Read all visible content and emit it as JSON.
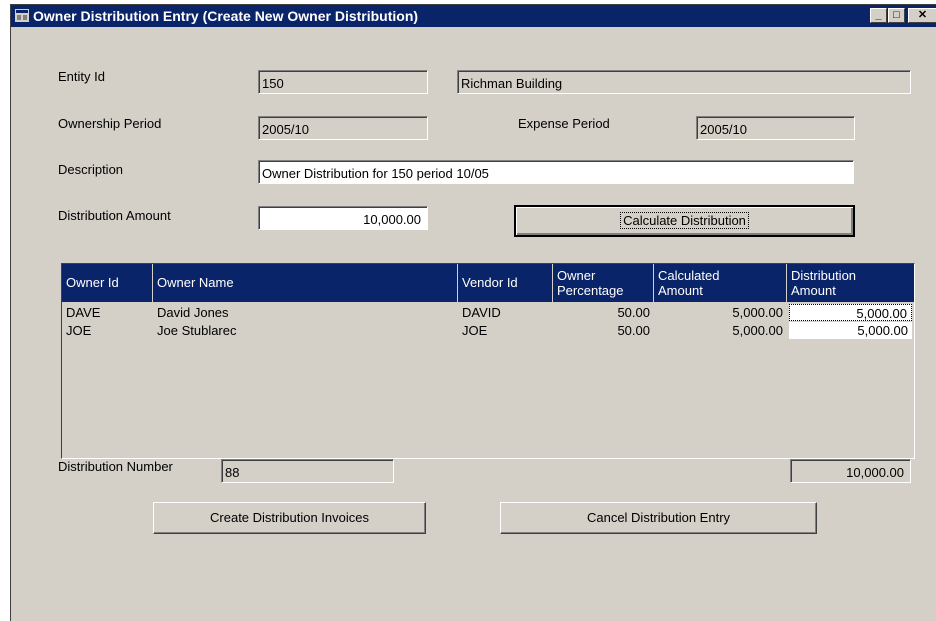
{
  "window": {
    "title": "Owner Distribution Entry (Create New Owner Distribution)"
  },
  "form": {
    "entity_label": "Entity Id",
    "entity_id": "150",
    "entity_name": "Richman Building",
    "ownership_period_label": "Ownership Period",
    "ownership_period": "2005/10",
    "expense_period_label": "Expense Period",
    "expense_period": "2005/10",
    "description_label": "Description",
    "description": "Owner Distribution for 150 period 10/05",
    "distribution_amount_label": "Distribution Amount",
    "distribution_amount": "10,000.00",
    "calculate_button": "Calculate Distribution"
  },
  "table": {
    "headers": [
      "Owner Id",
      "Owner Name",
      "Vendor Id",
      "Owner Percentage",
      "Calculated Amount",
      "Distribution Amount"
    ],
    "rows": [
      [
        "DAVE",
        "David Jones",
        "DAVID",
        "50.00",
        "5,000.00",
        "5,000.00"
      ],
      [
        "JOE",
        "Joe Stublarec",
        "JOE",
        "50.00",
        "5,000.00",
        "5,000.00"
      ]
    ]
  },
  "footer": {
    "distribution_number_label": "Distribution Number",
    "distribution_number": "88",
    "total": "10,000.00"
  },
  "buttons": {
    "create_invoices": "Create Distribution Invoices",
    "cancel_entry": "Cancel Distribution Entry"
  },
  "icons": {
    "app": "app-window-icon",
    "minimize": "minimize-icon",
    "maximize": "maximize-icon",
    "close": "close-icon"
  },
  "colors": {
    "title_bar": "#0a246a",
    "window_bg": "#d4d0c8"
  }
}
